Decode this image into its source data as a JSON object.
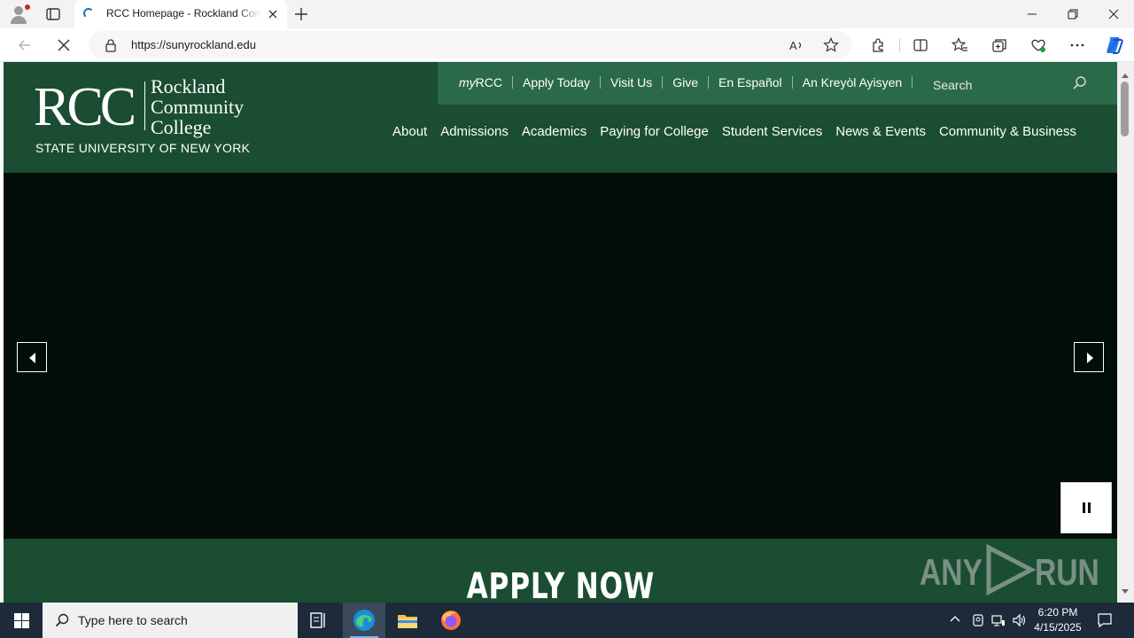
{
  "browser": {
    "tab_title": "RCC Homepage - Rockland Community College",
    "url_host": "https://sunyrockland.edu",
    "new_tab_symbol": "+"
  },
  "site": {
    "logo": {
      "initials": "RCC",
      "name_line1": "Rockland",
      "name_line2": "Community",
      "name_line3": "College",
      "affiliation": "STATE UNIVERSITY OF NEW YORK"
    },
    "utility_links": [
      {
        "prefix": "my",
        "label": "RCC"
      },
      {
        "label": "Apply Today"
      },
      {
        "label": "Visit Us"
      },
      {
        "label": "Give"
      },
      {
        "label": "En Español"
      },
      {
        "label": "An Kreyòl Ayisyen"
      }
    ],
    "search_placeholder": "Search",
    "main_nav": [
      "About",
      "Admissions",
      "Academics",
      "Paying for College",
      "Student Services",
      "News & Events",
      "Community & Business"
    ],
    "banner_text": "APPLY NOW",
    "watermark": {
      "left": "ANY",
      "right": "RUN"
    }
  },
  "taskbar": {
    "search_placeholder": "Type here to search",
    "time": "6:20 PM",
    "date": "4/15/2025"
  },
  "colors": {
    "site_green": "#1b4d32",
    "utility_green": "#2b6a48",
    "hero_black": "#020d07",
    "taskbar": "#1c2a3a"
  }
}
